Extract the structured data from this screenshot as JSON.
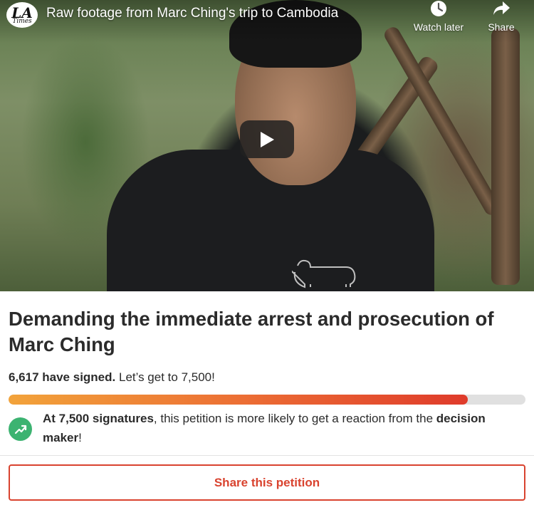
{
  "video": {
    "logo_big": "LA",
    "logo_small": "Times",
    "title": "Raw footage from Marc Ching's trip to Cambodia",
    "watch_later_label": "Watch later",
    "share_label": "Share",
    "icons": [
      "clock-icon",
      "share-arrow-icon",
      "play-icon"
    ]
  },
  "petition": {
    "title": "Demanding the immediate arrest and prosecution of Marc Ching",
    "signed_count_text": "6,617 have signed.",
    "goal_cta_text": "Let’s get to 7,500!",
    "progress_fraction": 0.889,
    "goal_strong": "At 7,500 signatures",
    "goal_middle": ", this petition is more likely to get a reaction from the ",
    "goal_decision": "decision maker",
    "goal_end": "!",
    "share_button_label": "Share this petition"
  },
  "colors": {
    "accent_red": "#d9432f",
    "progress_start": "#f2a33a",
    "progress_end": "#df3b2b",
    "goal_icon_green": "#3cb371"
  }
}
